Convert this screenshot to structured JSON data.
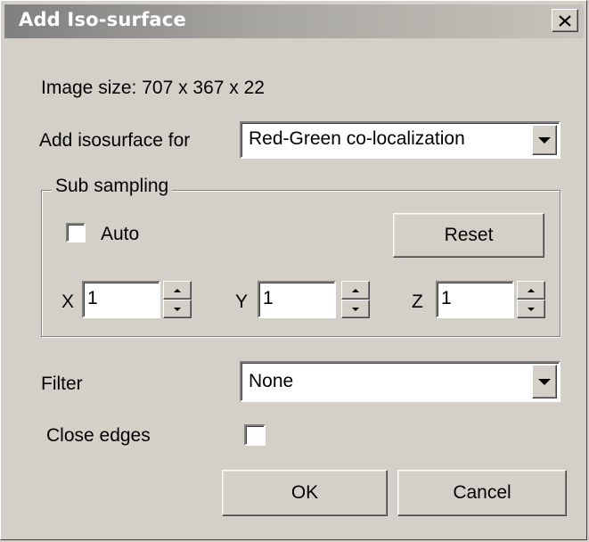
{
  "window": {
    "title": "Add Iso-surface",
    "close_icon": "close-icon"
  },
  "image_size_text": "Image size: 707 x 367 x 22",
  "isosurface": {
    "label": "Add isosurface for",
    "value": "Red-Green co-localization"
  },
  "subsampling": {
    "legend": "Sub sampling",
    "auto_label": "Auto",
    "auto_checked": false,
    "reset_label": "Reset",
    "x_label": "X",
    "x_value": "1",
    "y_label": "Y",
    "y_value": "1",
    "z_label": "Z",
    "z_value": "1"
  },
  "filter": {
    "label": "Filter",
    "value": "None"
  },
  "close_edges": {
    "label": "Close edges",
    "checked": false
  },
  "buttons": {
    "ok": "OK",
    "cancel": "Cancel"
  },
  "colors": {
    "face": "#d4d0c8",
    "title_gradient_start": "#808080",
    "title_gradient_end": "#c6c3bc"
  }
}
